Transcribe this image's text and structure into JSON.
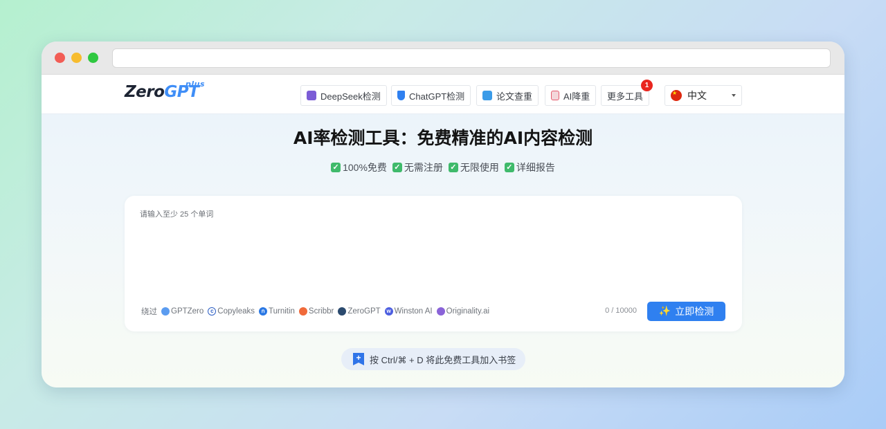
{
  "browser": {
    "url": ""
  },
  "logo": {
    "zero": "Zero",
    "gpt": "GPT",
    "plus": "plus"
  },
  "nav": {
    "items": [
      {
        "label": "DeepSeek检测",
        "icon": "deepseek-robot-icon",
        "color": "#7b5cd6"
      },
      {
        "label": "ChatGPT检测",
        "icon": "shield-icon",
        "color": "#2f80f0"
      },
      {
        "label": "论文查重",
        "icon": "refresh-icon",
        "color": "#3a9be8"
      },
      {
        "label": "AI降重",
        "icon": "document-edit-icon",
        "color": "#e45b6e"
      },
      {
        "label": "更多工具",
        "badge": "1"
      }
    ],
    "language": {
      "label": "中文",
      "icon": "china-flag-icon"
    }
  },
  "hero": {
    "title": "AI率检测工具：免费精准的AI内容检测",
    "features": [
      "100%免费",
      "无需注册",
      "无限使用",
      "详细报告"
    ]
  },
  "editor": {
    "placeholder": "请输入至少 25 个单词",
    "bypass_label": "绕过",
    "bypass_tools": [
      {
        "name": "GPTZero",
        "icon": "gptzero-icon",
        "color": "#5b9cf0"
      },
      {
        "name": "Copyleaks",
        "icon": "copyleaks-icon",
        "color": "#2d5fc4"
      },
      {
        "name": "Turnitin",
        "icon": "turnitin-icon",
        "color": "#2a78e4"
      },
      {
        "name": "Scribbr",
        "icon": "scribbr-icon",
        "color": "#f06a3a"
      },
      {
        "name": "ZeroGPT",
        "icon": "zerogpt-icon",
        "color": "#2b4a6e"
      },
      {
        "name": "Winston AI",
        "icon": "winston-icon",
        "color": "#4d5fe0"
      },
      {
        "name": "Originality.ai",
        "icon": "originality-icon",
        "color": "#8a63d8"
      }
    ],
    "counter": "0 / 10000",
    "detect_button": "立即检测"
  },
  "bookmark": {
    "text": "按 Ctrl/⌘ + D 将此免费工具加入书签"
  }
}
